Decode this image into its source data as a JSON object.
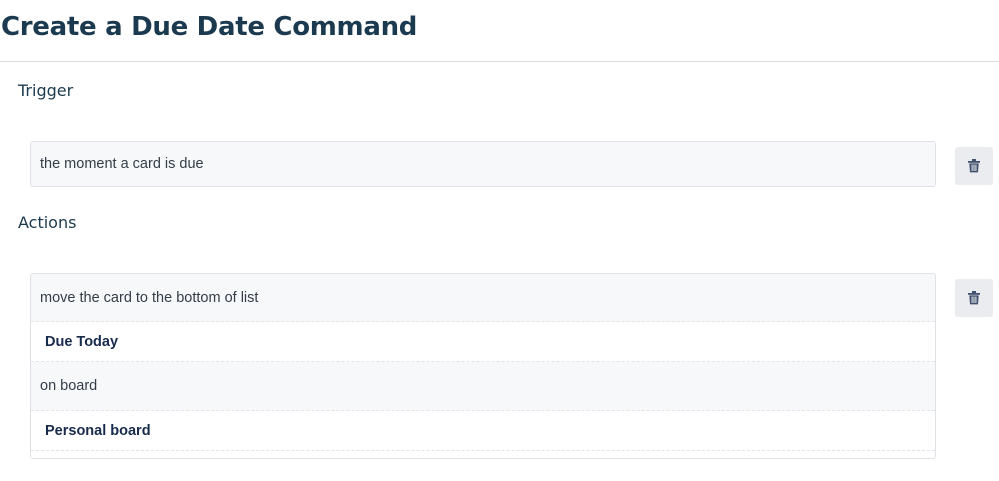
{
  "page": {
    "title": "Create a Due Date Command"
  },
  "trigger": {
    "heading": "Trigger",
    "text": "the moment a card is due",
    "delete_icon": "trash-icon"
  },
  "actions": {
    "heading": "Actions",
    "rows": [
      {
        "kind": "text",
        "label": "move the card to the bottom of list"
      },
      {
        "kind": "value",
        "label": "Due Today"
      },
      {
        "kind": "text",
        "label": "on board"
      },
      {
        "kind": "value",
        "label": "Personal board"
      }
    ],
    "delete_icon": "trash-icon"
  },
  "colors": {
    "heading": "#1b3a4f",
    "box_background": "#f7f8fa",
    "button_background": "#ebecf0",
    "icon": "#42526e"
  }
}
